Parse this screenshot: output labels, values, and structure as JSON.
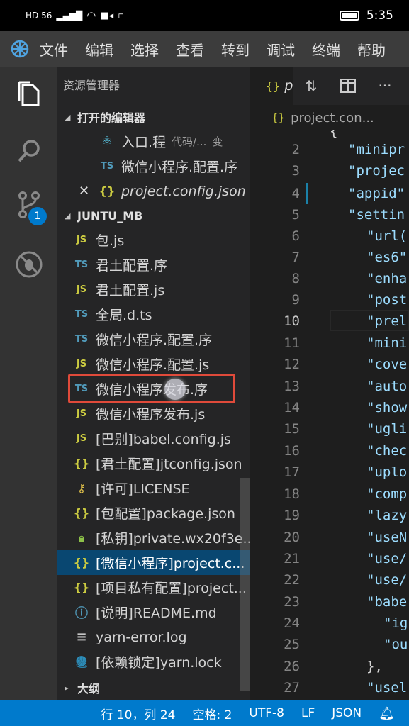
{
  "phone_status": {
    "left_indicators": "HD 56 ",
    "time": "5:35"
  },
  "menu": [
    "文件",
    "编辑",
    "选择",
    "查看",
    "转到",
    "调试",
    "终端",
    "帮助"
  ],
  "activity": {
    "scm_badge": "1"
  },
  "sidebar": {
    "title": "资源管理器",
    "open_editors_label": "打开的编辑器",
    "open_editors": [
      {
        "name": "入口.程",
        "detail": "代码/...",
        "extra": "变"
      },
      {
        "name": "微信小程序.配置.序"
      },
      {
        "name": "project.config.json"
      }
    ],
    "folder_label": "JUNTU_MB",
    "files": [
      {
        "icon": "JS",
        "name": "包.js"
      },
      {
        "icon": "TS",
        "name": "君土配置.序"
      },
      {
        "icon": "JS",
        "name": "君土配置.js"
      },
      {
        "icon": "TS",
        "name": "全局.d.ts"
      },
      {
        "icon": "TS",
        "name": "微信小程序.配置.序"
      },
      {
        "icon": "JS",
        "name": "微信小程序.配置.js"
      },
      {
        "icon": "TS",
        "name": "微信小程序发布.序"
      },
      {
        "icon": "JS",
        "name": "微信小程序发布.js"
      },
      {
        "icon": "JS",
        "name": "[巴别]babel.config.js"
      },
      {
        "icon": "{}",
        "name": "[君土配置]jtconfig.json"
      },
      {
        "icon": "key",
        "name": "[许可]LICENSE"
      },
      {
        "icon": "{}",
        "name": "[包配置]package.json"
      },
      {
        "icon": "lock",
        "name": "[私钥]private.wx20f3e..."
      },
      {
        "icon": "{}",
        "name": "[微信小程序]project.c..."
      },
      {
        "icon": "{}",
        "name": "[项目私有配置]project..."
      },
      {
        "icon": "info",
        "name": "[说明]README.md"
      },
      {
        "icon": "lines",
        "name": "yarn-error.log"
      },
      {
        "icon": "yarn",
        "name": "[依赖锁定]yarn.lock"
      }
    ],
    "outline_label": "大纲"
  },
  "editor": {
    "tab_label": "p",
    "breadcrumb": "project.con...",
    "lines": [
      {
        "n": "",
        "t": "{"
      },
      {
        "n": "2",
        "t": "\"minipr"
      },
      {
        "n": "3",
        "t": "\"projec"
      },
      {
        "n": "4",
        "t": "\"appid\""
      },
      {
        "n": "5",
        "t": "\"settin"
      },
      {
        "n": "6",
        "t": "\"url("
      },
      {
        "n": "7",
        "t": "\"es6\""
      },
      {
        "n": "8",
        "t": "\"enha"
      },
      {
        "n": "9",
        "t": "\"post"
      },
      {
        "n": "10",
        "t": "\"prel"
      },
      {
        "n": "11",
        "t": "\"mini"
      },
      {
        "n": "12",
        "t": "\"cove"
      },
      {
        "n": "13",
        "t": "\"auto"
      },
      {
        "n": "14",
        "t": "\"show"
      },
      {
        "n": "15",
        "t": "\"ugli"
      },
      {
        "n": "16",
        "t": "\"chec"
      },
      {
        "n": "17",
        "t": "\"uplo"
      },
      {
        "n": "18",
        "t": "\"comp"
      },
      {
        "n": "19",
        "t": "\"lazy"
      },
      {
        "n": "20",
        "t": "\"useN"
      },
      {
        "n": "21",
        "t": "\"use/"
      },
      {
        "n": "22",
        "t": "\"use/"
      },
      {
        "n": "23",
        "t": "\"babe"
      },
      {
        "n": "24",
        "t": "\"ig"
      },
      {
        "n": "25",
        "t": "\"ou"
      },
      {
        "n": "26",
        "t": "},"
      },
      {
        "n": "27",
        "t": "\"usel"
      }
    ]
  },
  "statusbar": {
    "position": "行 10，列 24",
    "indent": "空格: 2",
    "encoding": "UTF-8",
    "eol": "LF",
    "language": "JSON"
  }
}
